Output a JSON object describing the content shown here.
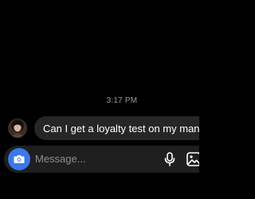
{
  "conversation": {
    "timestamp": "3:17 PM",
    "messages": [
      {
        "text": "Can I get a loyalty test on my man?",
        "avatar_icon": "profile-photo-avatar"
      }
    ]
  },
  "composer": {
    "placeholder": "Message...",
    "camera_icon": "camera-icon",
    "mic_icon": "microphone-icon",
    "gallery_icon": "gallery-icon",
    "accent_color": "#3a78ed"
  }
}
